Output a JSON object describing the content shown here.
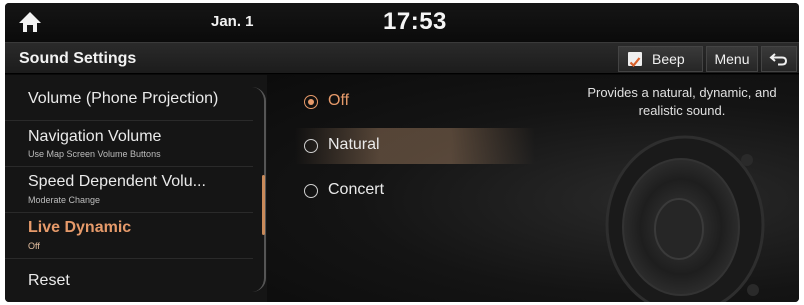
{
  "status": {
    "date": "Jan. 1",
    "time": "17:53"
  },
  "header": {
    "title": "Sound Settings",
    "beep_label": "Beep",
    "beep_checked": true,
    "menu_label": "Menu",
    "back_icon": "back-arrow-icon"
  },
  "sidebar": {
    "items": [
      {
        "label": "Volume (Phone Projection)",
        "sub": ""
      },
      {
        "label": "Navigation Volume",
        "sub": "Use Map Screen Volume Buttons"
      },
      {
        "label": "Speed Dependent Volu...",
        "sub": "Moderate Change"
      },
      {
        "label": "Live Dynamic",
        "sub": "Off",
        "active": true
      },
      {
        "label": "Reset",
        "sub": ""
      }
    ]
  },
  "options": [
    {
      "label": "Off",
      "selected": true
    },
    {
      "label": "Natural",
      "selected": false
    },
    {
      "label": "Concert",
      "selected": false
    }
  ],
  "description": "Provides a natural, dynamic, and realistic sound.",
  "colors": {
    "accent": "#e69a6a",
    "background": "#0a0a0a"
  }
}
